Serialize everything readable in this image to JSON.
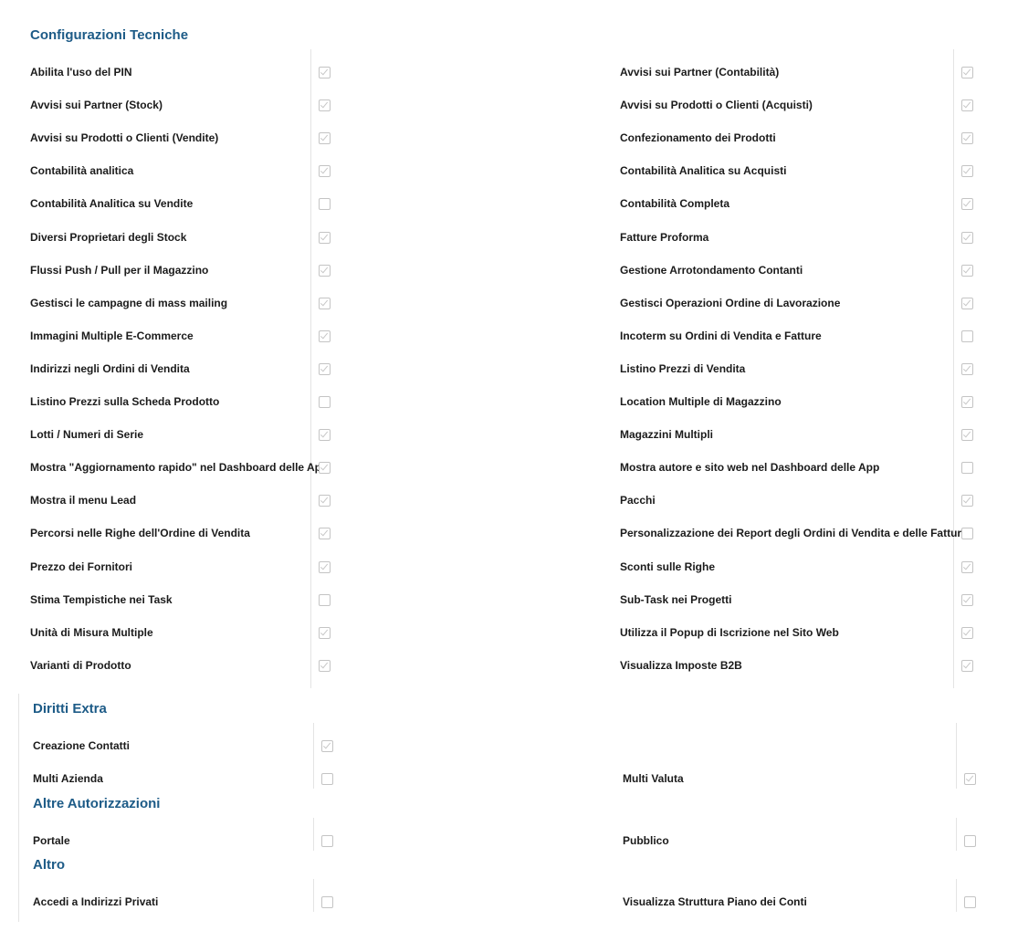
{
  "sections": {
    "tecniche": {
      "title": "Configurazioni Tecniche"
    },
    "diritti": {
      "title": "Diritti Extra"
    },
    "altre": {
      "title": "Altre Autorizzazioni"
    },
    "altro": {
      "title": "Altro"
    }
  },
  "tecniche_left": [
    {
      "label": "Abilita l'uso del PIN",
      "checked": true
    },
    {
      "label": "Avvisi sui Partner (Stock)",
      "checked": true
    },
    {
      "label": "Avvisi su Prodotti o Clienti (Vendite)",
      "checked": true
    },
    {
      "label": "Contabilità analitica",
      "checked": true
    },
    {
      "label": "Contabilità Analitica su Vendite",
      "checked": false
    },
    {
      "label": "Diversi Proprietari degli Stock",
      "checked": true
    },
    {
      "label": "Flussi Push / Pull per il Magazzino",
      "checked": true
    },
    {
      "label": "Gestisci le campagne di mass mailing",
      "checked": true
    },
    {
      "label": "Immagini Multiple E-Commerce",
      "checked": true
    },
    {
      "label": "Indirizzi negli Ordini di Vendita",
      "checked": true
    },
    {
      "label": "Listino Prezzi sulla Scheda Prodotto",
      "checked": false
    },
    {
      "label": "Lotti / Numeri di Serie",
      "checked": true
    },
    {
      "label": "Mostra \"Aggiornamento rapido\" nel Dashboard delle App",
      "checked": true
    },
    {
      "label": "Mostra il menu Lead",
      "checked": true
    },
    {
      "label": "Percorsi nelle Righe dell'Ordine di Vendita",
      "checked": true
    },
    {
      "label": "Prezzo dei Fornitori",
      "checked": true
    },
    {
      "label": "Stima Tempistiche nei Task",
      "checked": false
    },
    {
      "label": "Unità di Misura Multiple",
      "checked": true
    },
    {
      "label": "Varianti di Prodotto",
      "checked": true
    }
  ],
  "tecniche_right": [
    {
      "label": "Avvisi sui Partner (Contabilità)",
      "checked": true
    },
    {
      "label": "Avvisi su Prodotti o Clienti (Acquisti)",
      "checked": true
    },
    {
      "label": "Confezionamento dei Prodotti",
      "checked": true
    },
    {
      "label": "Contabilità Analitica su Acquisti",
      "checked": true
    },
    {
      "label": "Contabilità Completa",
      "checked": true
    },
    {
      "label": "Fatture Proforma",
      "checked": true
    },
    {
      "label": "Gestione Arrotondamento Contanti",
      "checked": true
    },
    {
      "label": "Gestisci Operazioni Ordine di Lavorazione",
      "checked": true
    },
    {
      "label": "Incoterm su Ordini di Vendita e Fatture",
      "checked": false
    },
    {
      "label": "Listino Prezzi di Vendita",
      "checked": true
    },
    {
      "label": "Location Multiple di Magazzino",
      "checked": true
    },
    {
      "label": "Magazzini Multipli",
      "checked": true
    },
    {
      "label": "Mostra autore e sito web nel Dashboard delle App",
      "checked": false
    },
    {
      "label": "Pacchi",
      "checked": true
    },
    {
      "label": "Personalizzazione dei Report degli Ordini di Vendita e delle Fatture",
      "checked": false
    },
    {
      "label": "Sconti sulle Righe",
      "checked": true
    },
    {
      "label": "Sub-Task nei Progetti",
      "checked": true
    },
    {
      "label": "Utilizza il Popup di Iscrizione nel Sito Web",
      "checked": true
    },
    {
      "label": "Visualizza Imposte B2B",
      "checked": true
    }
  ],
  "diritti_rows": [
    {
      "left": {
        "label": "Creazione Contatti",
        "checked": true
      },
      "right": null
    },
    {
      "left": {
        "label": "Multi Azienda",
        "checked": false
      },
      "right": {
        "label": "Multi Valuta",
        "checked": true
      }
    }
  ],
  "altre_rows": [
    {
      "left": {
        "label": "Portale",
        "checked": false
      },
      "right": {
        "label": "Pubblico",
        "checked": false
      }
    }
  ],
  "altro_rows": [
    {
      "left": {
        "label": "Accedi a Indirizzi Privati",
        "checked": false
      },
      "right": {
        "label": "Visualizza Struttura Piano dei Conti",
        "checked": false
      }
    }
  ]
}
